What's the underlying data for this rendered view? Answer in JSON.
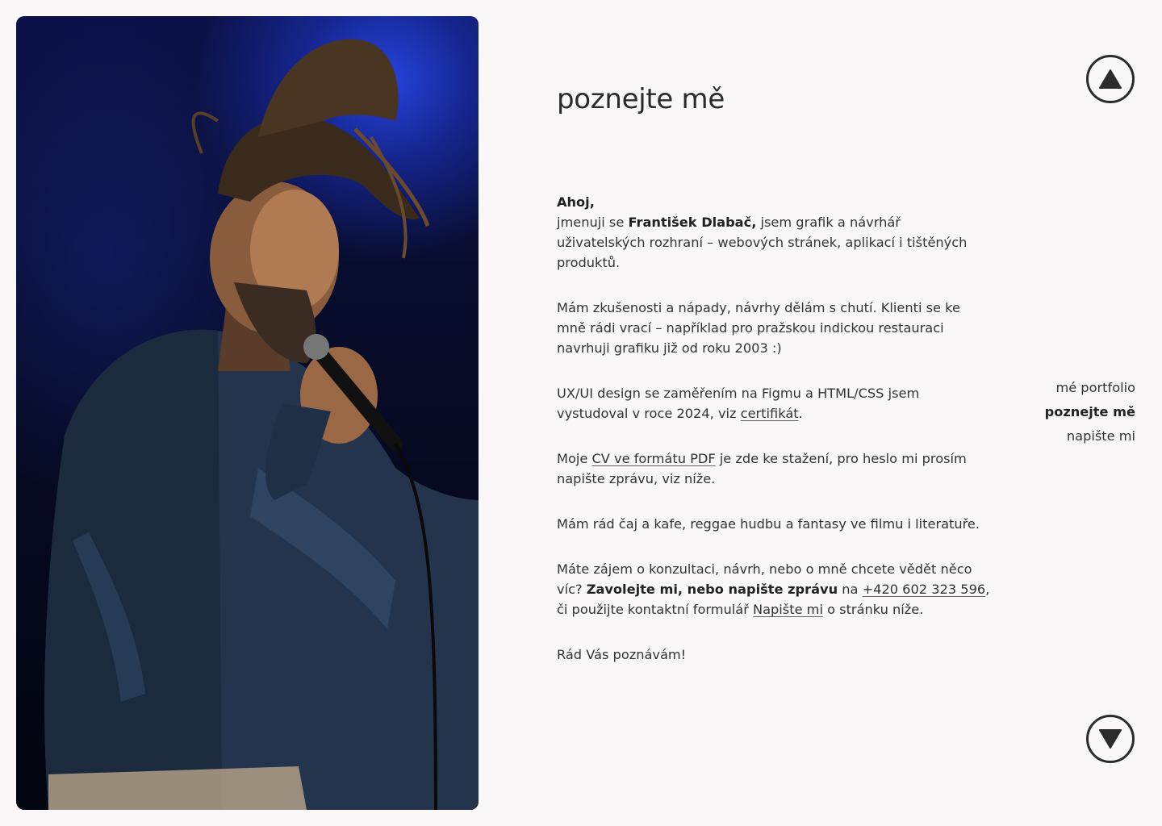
{
  "photo": {
    "alt_icon": "singer-photo"
  },
  "section": {
    "title": "poznejte mě"
  },
  "intro": {
    "greeting": "Ahoj,",
    "line_prefix": "jmenuji se ",
    "name": "František Dlabač,",
    "line_suffix": " jsem grafik a návrhář uživatelských rozhraní – webových stránek, aplikací i tištěných produktů."
  },
  "paragraph_experience": "Mám zkušenosti a nápady, návrhy dělám s chutí. Klienti se ke mně rádi vrací – například pro pražskou indickou restauraci navrhuji grafiku již od roku 2003 :)",
  "paragraph_ux": {
    "text": "UX/UI design se zaměřením na Figmu a HTML/CSS jsem vystudoval v roce 2024, viz ",
    "link": "certifikát",
    "end": "."
  },
  "paragraph_cv": {
    "prefix": "Moje ",
    "link": "CV ve formátu PDF",
    "suffix": " je zde ke stažení, pro heslo mi prosím napište zprávu, viz níže."
  },
  "paragraph_hobbies": "Mám rád čaj a kafe, reggae hudbu a fantasy ve filmu i literatuře.",
  "paragraph_contact": {
    "prefix": "Máte zájem o konzultaci, návrh, nebo o mně chcete vědět něco víc? ",
    "bold": "Zavolejte mi, nebo napište zprávu",
    "middle": " na ",
    "phone": "+420 602 323 596",
    "middle2": ", či použijte kontaktní formulář ",
    "form_link": "Napište mi",
    "suffix": " o stránku níže."
  },
  "closing": "Rád Vás poznávám!",
  "side_nav": {
    "items": [
      {
        "label": "mé portfolio",
        "active": false
      },
      {
        "label": "poznejte mě",
        "active": true
      },
      {
        "label": "napište mi",
        "active": false
      }
    ]
  },
  "buttons": {
    "up_icon": "triangle-up-icon",
    "down_icon": "triangle-down-icon"
  },
  "colors": {
    "background": "#f9f7f8",
    "text": "#2b2b2b",
    "stage_light": "#2846e6"
  }
}
